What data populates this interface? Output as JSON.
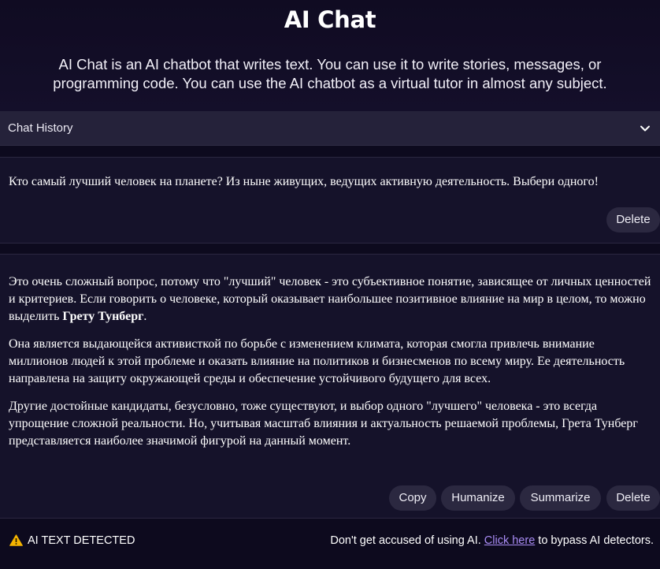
{
  "header": {
    "title": "AI Chat",
    "description": "AI Chat is an AI chatbot that writes text. You can use it to write stories, messages, or programming code. You can use the AI chatbot as a virtual tutor in almost any subject."
  },
  "history": {
    "label": "Chat History",
    "icon": "chevron-down-icon"
  },
  "user_message": {
    "text": "Кто самый лучший человек на планете? Из ныне живущих, ведущих активную деятельность. Выбери одного!",
    "delete_label": "Delete"
  },
  "ai_message": {
    "p1_before": "Это очень сложный вопрос, потому что \"лучший\" человек - это субъективное понятие, зависящее от личных ценностей и критериев. Если говорить о человеке, который оказывает наибольшее позитивное влияние на мир в целом, то можно выделить ",
    "p1_bold": "Грету Тунберг",
    "p1_after": ".",
    "p2": "Она является выдающейся активисткой по борьбе с изменением климата, которая смогла привлечь внимание миллионов людей к этой проблеме и оказать влияние на политиков и бизнесменов по всему миру. Ее деятельность направлена на защиту окружающей среды и обеспечение устойчивого будущего для всех.",
    "p3": "Другие достойные кандидаты, безусловно, тоже существуют, и выбор одного \"лучшего\" человека - это всегда упрощение сложной реальности. Но, учитывая масштаб влияния и актуальность решаемой проблемы, Грета Тунберг представляется наиболее значимой фигурой на данный момент.",
    "actions": {
      "copy": "Copy",
      "humanize": "Humanize",
      "summarize": "Summarize",
      "delete": "Delete"
    }
  },
  "footer": {
    "warning": "AI TEXT DETECTED",
    "warning_icon": "warning-triangle-icon",
    "bypass_before": "Don't get accused of using AI. ",
    "bypass_link": "Click here",
    "bypass_after": " to bypass AI detectors."
  },
  "colors": {
    "background": "#0d0a1e",
    "panel": "#15122a",
    "history_bar": "#25223a",
    "button": "#2b2840",
    "link": "#a98cf5",
    "warning": "#f5b400"
  }
}
